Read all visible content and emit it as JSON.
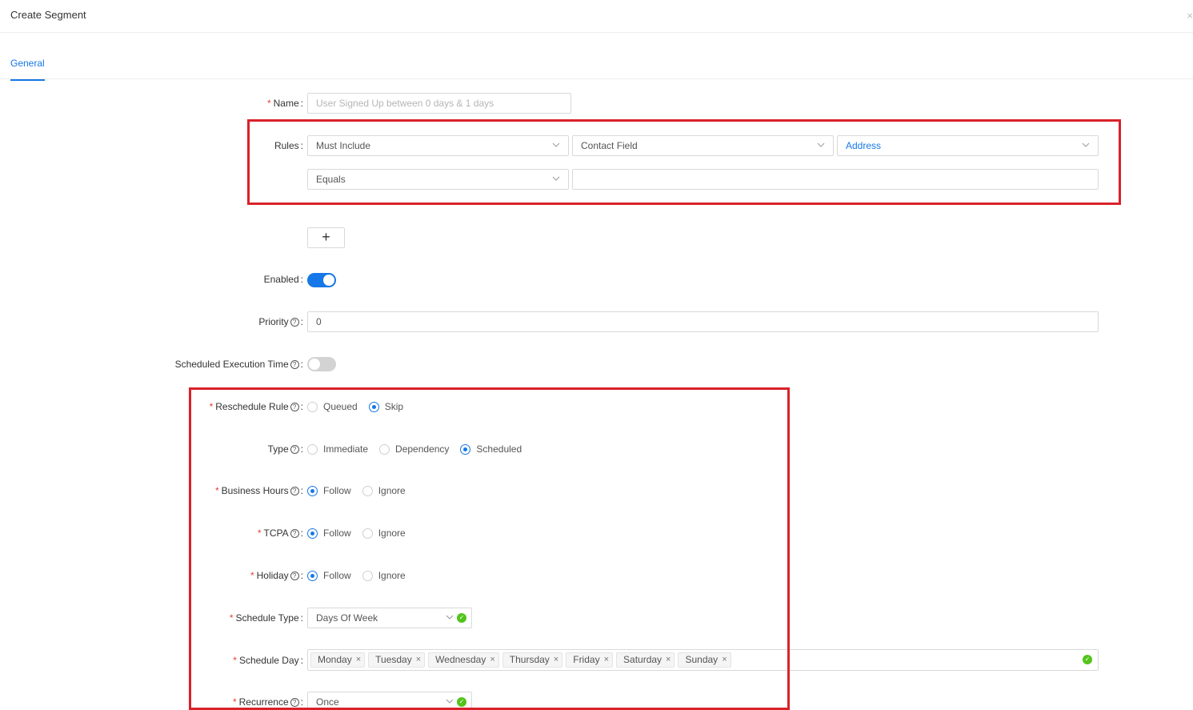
{
  "header": {
    "title": "Create Segment",
    "close_glyph": "×"
  },
  "tabs": [
    {
      "label": "General"
    }
  ],
  "form": {
    "name": {
      "label": "Name",
      "placeholder": "User Signed Up between 0 days & 1 days"
    },
    "rules": {
      "label": "Rules",
      "include": "Must Include",
      "field_type": "Contact Field",
      "field": "Address",
      "operator": "Equals",
      "value": ""
    },
    "add_rule": "+",
    "enabled": {
      "label": "Enabled",
      "on": true
    },
    "priority": {
      "label": "Priority",
      "value": "0"
    },
    "scheduled_execution": {
      "label": "Scheduled Execution Time",
      "on": false
    },
    "reschedule_rule": {
      "label": "Reschedule Rule",
      "options": [
        "Queued",
        "Skip"
      ],
      "selected": "Skip"
    },
    "type": {
      "label": "Type",
      "options": [
        "Immediate",
        "Dependency",
        "Scheduled"
      ],
      "selected": "Scheduled"
    },
    "business_hours": {
      "label": "Business Hours",
      "options": [
        "Follow",
        "Ignore"
      ],
      "selected": "Follow"
    },
    "tcpa": {
      "label": "TCPA",
      "options": [
        "Follow",
        "Ignore"
      ],
      "selected": "Follow"
    },
    "holiday": {
      "label": "Holiday",
      "options": [
        "Follow",
        "Ignore"
      ],
      "selected": "Follow"
    },
    "schedule_type": {
      "label": "Schedule Type",
      "value": "Days Of Week"
    },
    "schedule_day": {
      "label": "Schedule Day",
      "values": [
        "Monday",
        "Tuesday",
        "Wednesday",
        "Thursday",
        "Friday",
        "Saturday",
        "Sunday"
      ]
    },
    "recurrence": {
      "label": "Recurrence",
      "value": "Once"
    }
  },
  "colors": {
    "accent": "#1677e8",
    "highlight": "#d9222a",
    "success": "#52c41a",
    "required": "#e5423b"
  },
  "icons": {
    "help": "question-circle-icon",
    "chevron": "chevron-down-icon",
    "check": "check-circle-icon",
    "remove": "close-icon"
  }
}
